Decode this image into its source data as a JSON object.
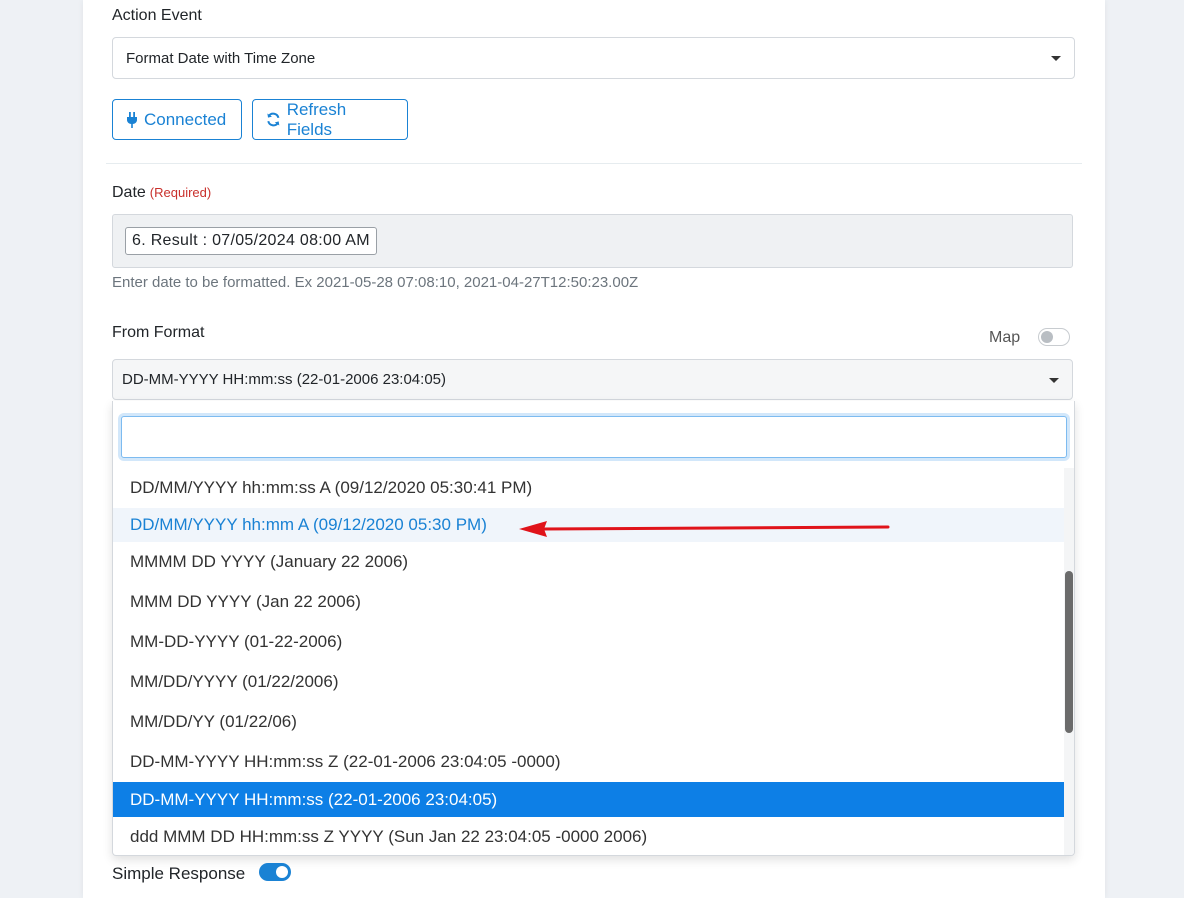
{
  "action_event": {
    "label": "Action Event",
    "value": "Format Date with Time Zone"
  },
  "buttons": {
    "connected": "Connected",
    "refresh": "Refresh Fields"
  },
  "date_field": {
    "label": "Date",
    "required": "(Required)",
    "chip": "6. Result : 07/05/2024 08:00 AM",
    "help": "Enter date to be formatted. Ex 2021-05-28 07:08:10, 2021-04-27T12:50:23.00Z"
  },
  "from_format": {
    "label": "From Format",
    "map_label": "Map",
    "value": "DD-MM-YYYY HH:mm:ss (22-01-2006 23:04:05)",
    "search_value": "",
    "options": [
      "DD/MM/YYYY hh:mm:ss A (09/12/2020 05:30:41 PM)",
      "DD/MM/YYYY hh:mm A (09/12/2020 05:30 PM)",
      "MMMM DD YYYY (January 22 2006)",
      "MMM DD YYYY (Jan 22 2006)",
      "MM-DD-YYYY (01-22-2006)",
      "MM/DD/YYYY (01/22/2006)",
      "MM/DD/YY (01/22/06)",
      "DD-MM-YYYY HH:mm:ss Z (22-01-2006 23:04:05 -0000)",
      "DD-MM-YYYY HH:mm:ss (22-01-2006 23:04:05)",
      "ddd MMM DD HH:mm:ss Z YYYY (Sun Jan 22 23:04:05 -0000 2006)"
    ],
    "hovered_index": 1,
    "selected_index": 8
  },
  "simple_response": {
    "label": "Simple Response",
    "enabled": true
  },
  "colors": {
    "accent": "#1a82d4",
    "selected_bg": "#0d7fe6",
    "required": "#c9302c",
    "arrow": "#e0131a"
  }
}
